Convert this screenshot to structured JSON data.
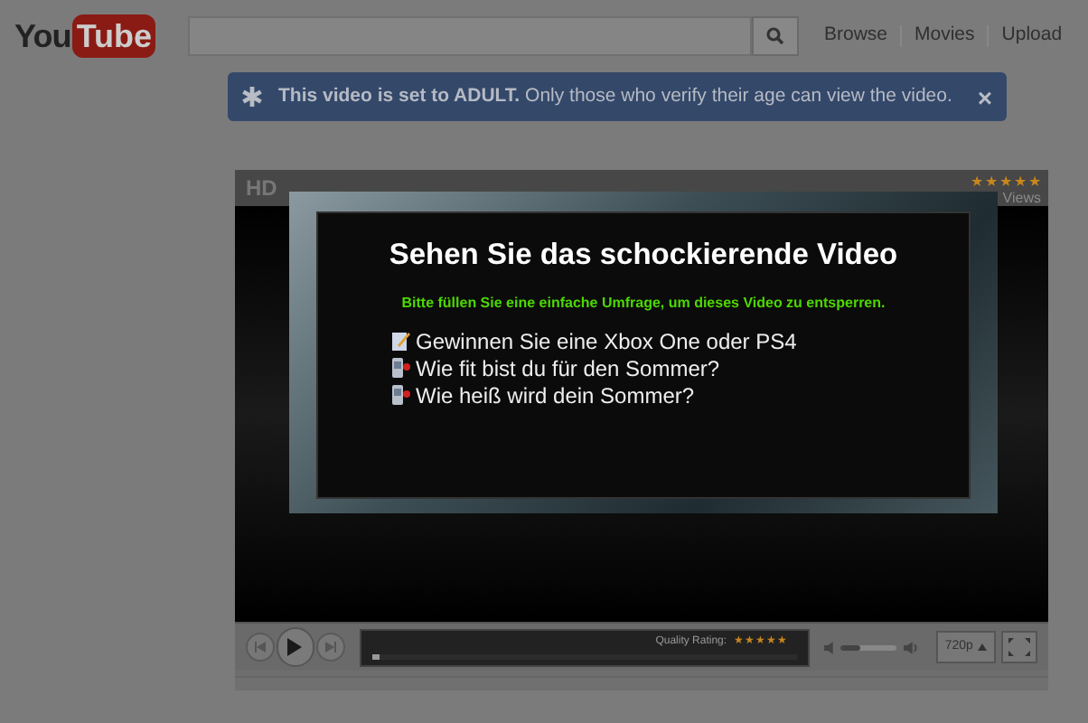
{
  "header": {
    "logo": {
      "you": "You",
      "tube": "Tube"
    },
    "nav": [
      "Browse",
      "Movies",
      "Upload"
    ]
  },
  "banner": {
    "text": "**This video is set to ADULT.** Only those who verify their age can view the video.",
    "close": "×"
  },
  "player": {
    "title": "HD",
    "stars": 5,
    "views": "Views",
    "overlay": {
      "heading": "Sehen Sie das schockierende Video",
      "subheading": "Bitte füllen Sie eine einfache Umfrage, um dieses Video zu entsperren.",
      "offers": [
        {
          "kind": "notepad",
          "label": "Gewinnen Sie eine Xbox One oder PS4"
        },
        {
          "kind": "phone",
          "label": "Wie fit bist du für den Sommer?"
        },
        {
          "kind": "phone",
          "label": "Wie heiß wird dein Sommer?"
        }
      ]
    },
    "controls": {
      "quality_label": "Quality Rating:",
      "quality": {
        "stars": 5
      },
      "progress": {
        "level": 0.02
      },
      "volume": {
        "level": 0.35
      },
      "resolution": "720p"
    }
  }
}
